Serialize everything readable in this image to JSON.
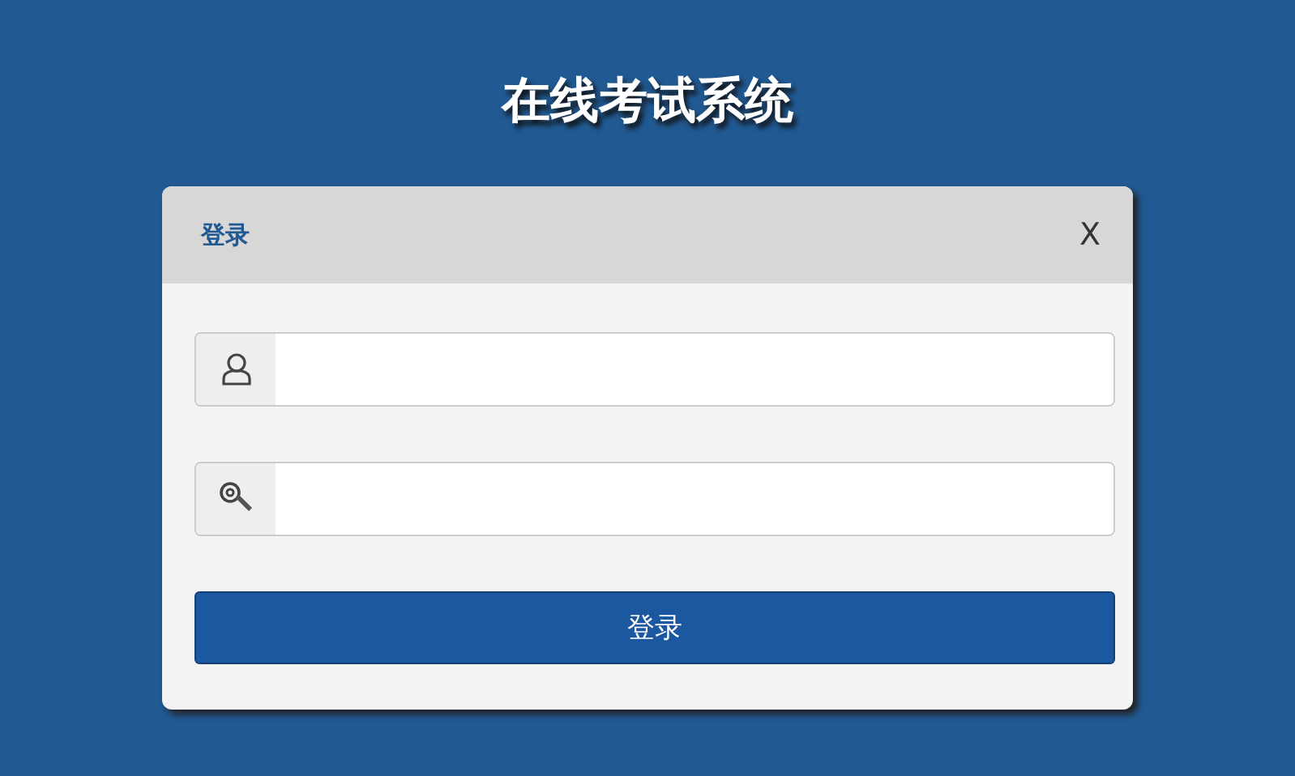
{
  "title": "在线考试系统",
  "dialog": {
    "title": "登录",
    "close": "X",
    "fields": [
      {
        "kind": "user"
      },
      {
        "kind": "key"
      }
    ],
    "submit": "登录"
  }
}
